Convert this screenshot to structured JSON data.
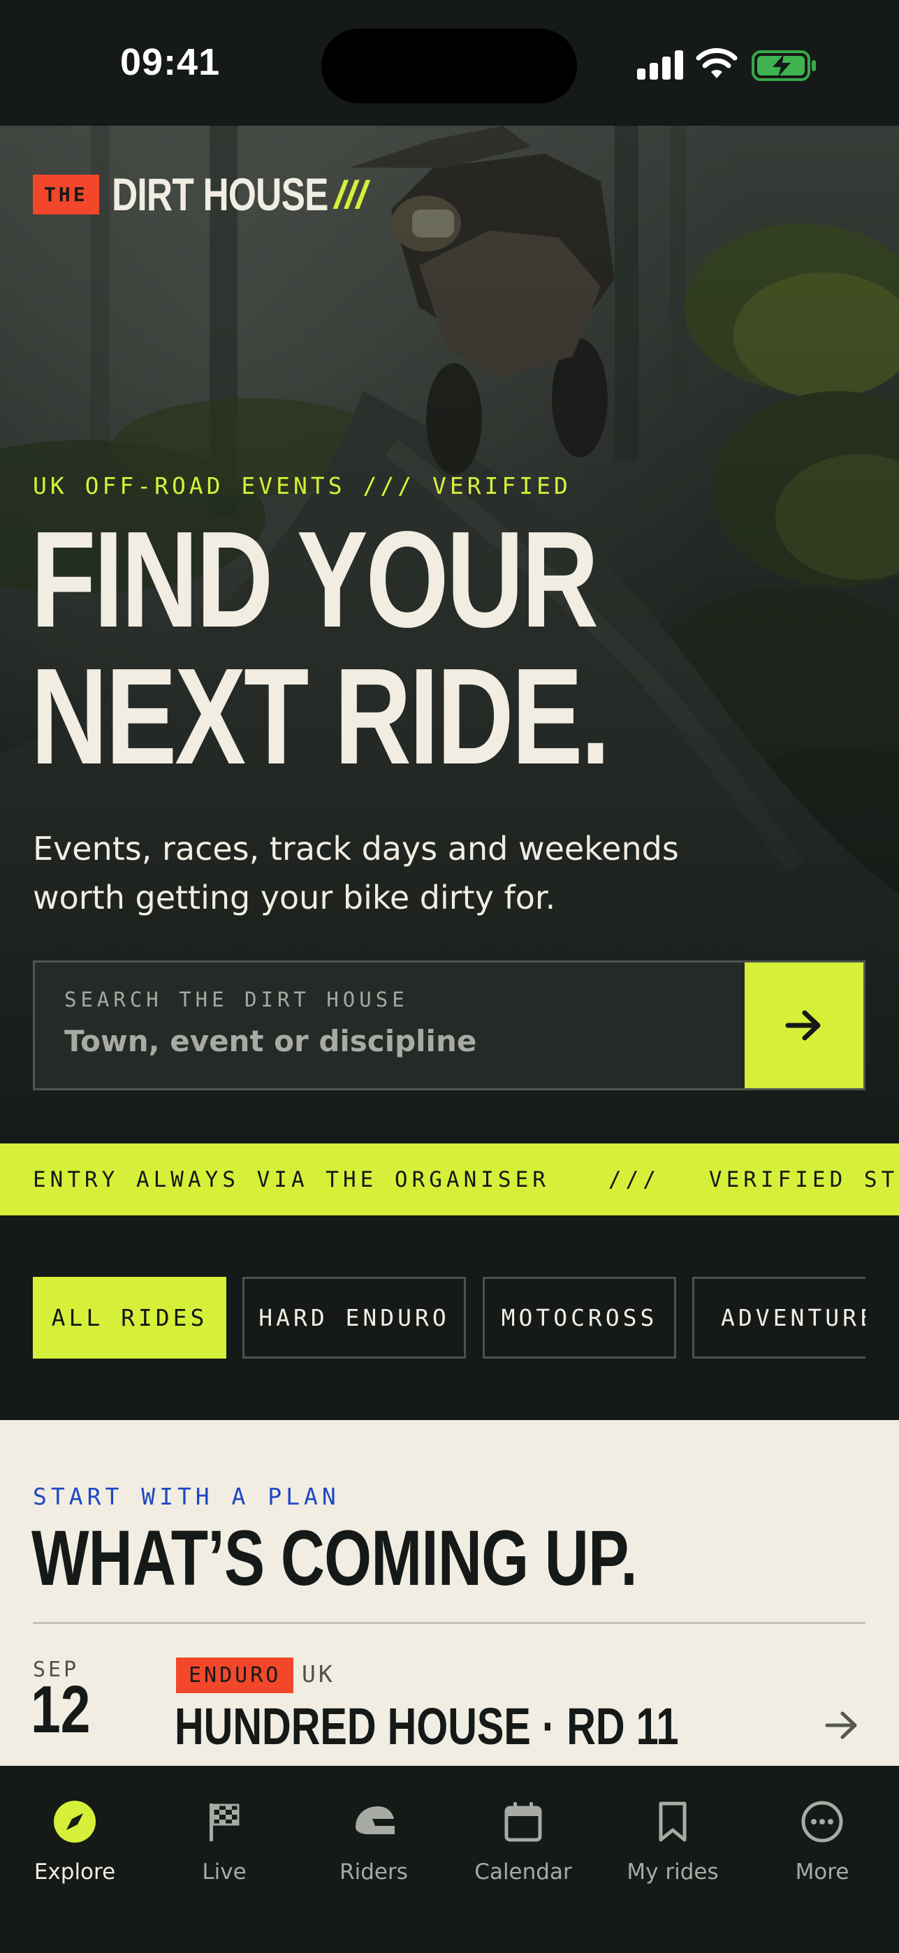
{
  "status_bar": {
    "time": "09:41"
  },
  "brand": {
    "the": "THE",
    "name": "DIRT HOUSE",
    "slashes": "///"
  },
  "hero": {
    "eyebrow": "UK OFF-ROAD EVENTS  /// VERIFIED",
    "headline_line1": "FIND YOUR",
    "headline_line2": "NEXT RIDE.",
    "subtitle": "Events, races, track days and weekends worth getting your bike dirty for."
  },
  "search": {
    "label": "SEARCH THE DIRT HOUSE",
    "placeholder": "Town, event or discipline"
  },
  "ticker": {
    "item1": "ENTRY ALWAYS VIA THE ORGANISER",
    "separator": "///",
    "item2": "VERIFIED STAT…"
  },
  "filters": [
    "ALL RIDES",
    "HARD ENDURO",
    "MOTOCROSS",
    "ADVENTURE"
  ],
  "section": {
    "eyebrow": "START WITH A PLAN",
    "title": "WHAT’S COMING UP."
  },
  "event": {
    "month": "SEP",
    "day": "12",
    "tag": "ENDURO",
    "region": "UK",
    "title": "HUNDRED HOUSE · RD 11"
  },
  "tabs": [
    "Explore",
    "Live",
    "Riders",
    "Calendar",
    "My rides",
    "More"
  ],
  "colors": {
    "accent": "#d6f03a",
    "brand_red": "#f2472b",
    "dark": "#151917",
    "cream": "#f1ede2",
    "link_blue": "#1f48c2"
  }
}
